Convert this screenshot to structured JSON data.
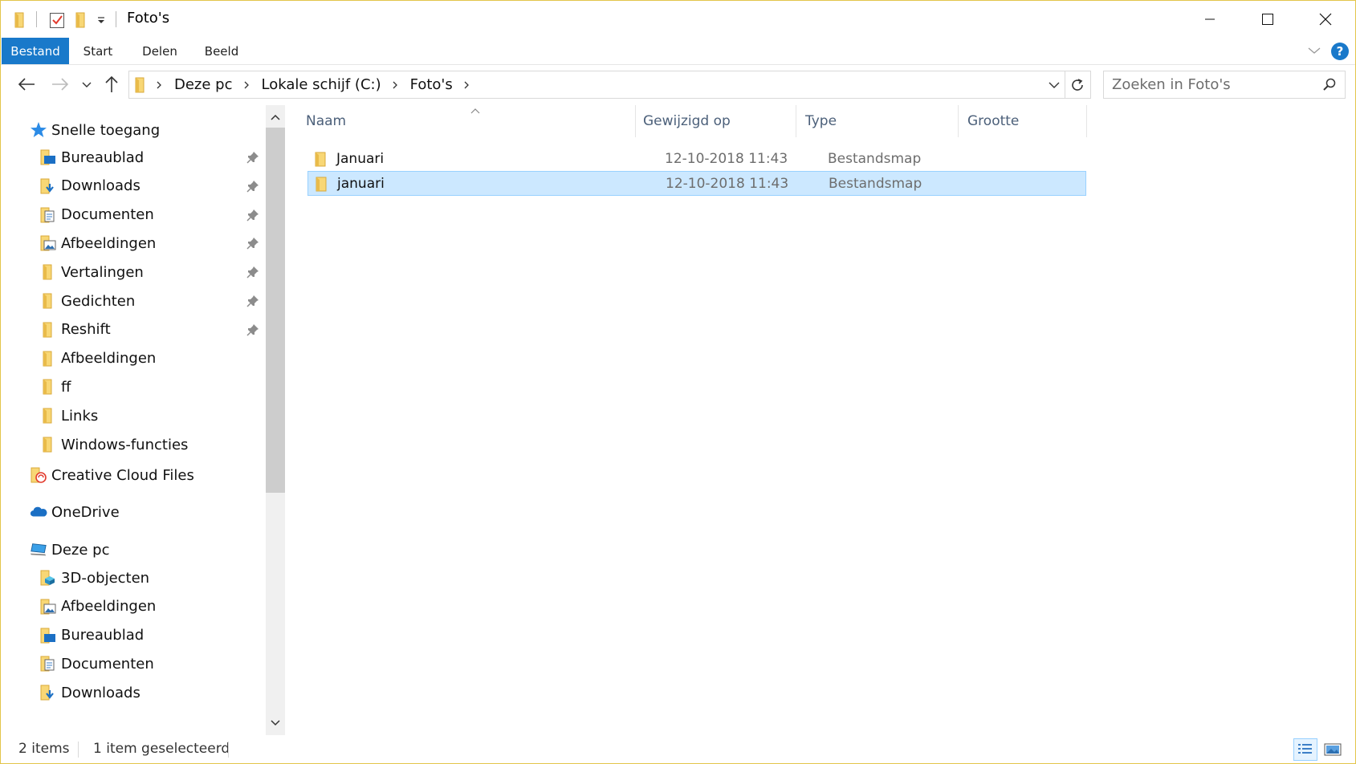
{
  "window": {
    "title": "Foto's",
    "border_color": "#e3c54a"
  },
  "ribbon": {
    "tabs": [
      {
        "label": "Bestand"
      },
      {
        "label": "Start"
      },
      {
        "label": "Delen"
      },
      {
        "label": "Beeld"
      }
    ],
    "help_label": "?"
  },
  "address": {
    "segments": [
      "Deze pc",
      "Lokale schijf (C:)",
      "Foto's"
    ]
  },
  "search": {
    "placeholder": "Zoeken in Foto's"
  },
  "navigation": {
    "quick_access": {
      "label": "Snelle toegang",
      "items": [
        {
          "label": "Bureaublad",
          "icon": "desktop-folder-icon",
          "pinned": true
        },
        {
          "label": "Downloads",
          "icon": "downloads-folder-icon",
          "pinned": true
        },
        {
          "label": "Documenten",
          "icon": "documents-folder-icon",
          "pinned": true
        },
        {
          "label": "Afbeeldingen",
          "icon": "pictures-folder-icon",
          "pinned": true
        },
        {
          "label": "Vertalingen",
          "icon": "folder-icon",
          "pinned": true
        },
        {
          "label": "Gedichten",
          "icon": "folder-icon",
          "pinned": true
        },
        {
          "label": "Reshift",
          "icon": "folder-icon",
          "pinned": true
        },
        {
          "label": "Afbeeldingen",
          "icon": "folder-icon",
          "pinned": false
        },
        {
          "label": "ff",
          "icon": "folder-icon",
          "pinned": false
        },
        {
          "label": "Links",
          "icon": "folder-icon",
          "pinned": false
        },
        {
          "label": "Windows-functies",
          "icon": "folder-icon",
          "pinned": false
        }
      ]
    },
    "creative_cloud": {
      "label": "Creative Cloud Files"
    },
    "onedrive": {
      "label": "OneDrive"
    },
    "this_pc": {
      "label": "Deze pc",
      "items": [
        {
          "label": "3D-objecten"
        },
        {
          "label": "Afbeeldingen"
        },
        {
          "label": "Bureaublad"
        },
        {
          "label": "Documenten"
        },
        {
          "label": "Downloads"
        }
      ]
    }
  },
  "file_list": {
    "columns": [
      "Naam",
      "Gewijzigd op",
      "Type",
      "Grootte"
    ],
    "rows": [
      {
        "name": "Januari",
        "modified": "12-10-2018 11:43",
        "type": "Bestandsmap",
        "size": "",
        "selected": false
      },
      {
        "name": "januari",
        "modified": "12-10-2018 11:43",
        "type": "Bestandsmap",
        "size": "",
        "selected": true
      }
    ]
  },
  "status": {
    "items_count": "2 items",
    "selection": "1 item geselecteerd"
  },
  "colors": {
    "accent": "#1979ca",
    "selection_bg": "#cce8ff",
    "selection_border": "#99d1ff",
    "folder_yellow": "#f8d775"
  }
}
